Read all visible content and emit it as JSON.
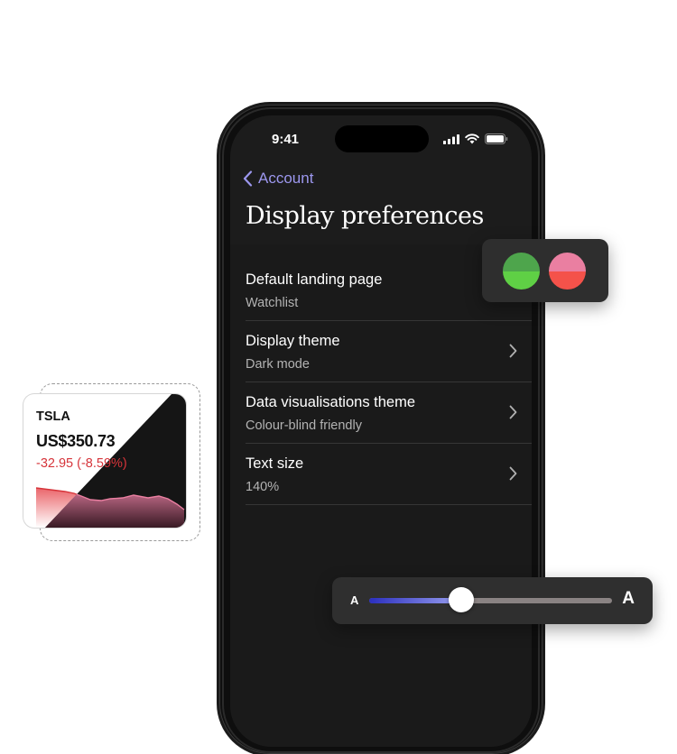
{
  "status_bar": {
    "time": "9:41"
  },
  "nav": {
    "back_label": "Account"
  },
  "page": {
    "title": "Display preferences"
  },
  "settings": [
    {
      "title": "Default landing page",
      "value": "Watchlist"
    },
    {
      "title": "Display theme",
      "value": "Dark mode"
    },
    {
      "title": "Data visualisations theme",
      "value": "Colour-blind friendly"
    },
    {
      "title": "Text size",
      "value": "140%"
    }
  ],
  "colour_swatches": [
    {
      "name": "positive",
      "top": "#4ea54c",
      "bottom": "#5fd045"
    },
    {
      "name": "negative",
      "top": "#ea7fa1",
      "bottom": "#f4524a"
    }
  ],
  "text_size_slider": {
    "small_label": "A",
    "large_label": "A",
    "level": 0.38
  },
  "stock_card": {
    "symbol": "TSLA",
    "price": "US$350.73",
    "change": "-32.95 (-8.59%)"
  },
  "colors": {
    "accent": "#9c97ee",
    "negative": "#d6343a",
    "background": "#1c1c1c"
  }
}
